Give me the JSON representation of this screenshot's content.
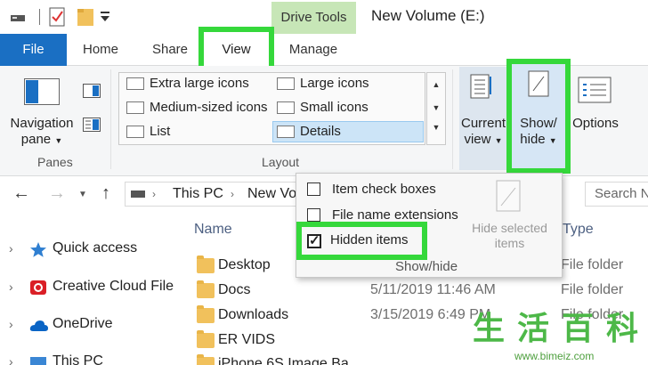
{
  "window": {
    "context_tab": "Drive Tools",
    "title": "New Volume (E:)"
  },
  "tabs": {
    "file": "File",
    "home": "Home",
    "share": "Share",
    "view": "View",
    "manage": "Manage"
  },
  "ribbon": {
    "panes": {
      "navigation_pane": "Navigation",
      "navigation_pane_line2": "pane",
      "group_label": "Panes"
    },
    "layout": {
      "items": {
        "extra_large": "Extra large icons",
        "large": "Large icons",
        "medium": "Medium-sized icons",
        "small": "Small icons",
        "list": "List",
        "details": "Details"
      },
      "group_label": "Layout"
    },
    "current_view": {
      "line1": "Current",
      "line2": "view"
    },
    "show_hide": {
      "line1": "Show/",
      "line2": "hide"
    },
    "options": {
      "label": "Options"
    }
  },
  "address_bar": {
    "this_pc": "This PC",
    "current": "New Vo",
    "search_placeholder": "Search N"
  },
  "nav_pane": {
    "items": [
      {
        "label": "Quick access",
        "icon": "star-icon"
      },
      {
        "label": "Creative Cloud File",
        "icon": "creative-cloud-icon"
      },
      {
        "label": "OneDrive",
        "icon": "cloud-icon"
      },
      {
        "label": "This PC",
        "icon": "computer-icon"
      }
    ]
  },
  "file_list": {
    "columns": {
      "name": "Name",
      "type": "Type"
    },
    "rows": [
      {
        "name": "Desktop",
        "date": "",
        "type": "File folder"
      },
      {
        "name": "Docs",
        "date": "5/11/2019 11:46 AM",
        "type": "File folder"
      },
      {
        "name": "Downloads",
        "date": "3/15/2019 6:49 PM",
        "type": "File folder"
      },
      {
        "name": "ER VIDS",
        "date": "",
        "type": ""
      },
      {
        "name": "iPhone 6S Image Ba",
        "date": "",
        "type": ""
      }
    ]
  },
  "show_hide_menu": {
    "item_check_boxes": "Item check boxes",
    "file_name_extensions": "File name extensions",
    "hidden_items": "Hidden items",
    "hidden_items_checked": true,
    "hide_selected": "Hide selected",
    "hide_selected_line2": "items",
    "footer": "Show/hide"
  },
  "watermark": {
    "chars": [
      "生",
      "活",
      "百",
      "科"
    ],
    "url": "www.bimeiz.com"
  },
  "colors": {
    "highlight": "#35d83b",
    "file_tab": "#1a6fc3",
    "drive_tools": "#c7e6b7",
    "folder": "#f1c15c"
  }
}
